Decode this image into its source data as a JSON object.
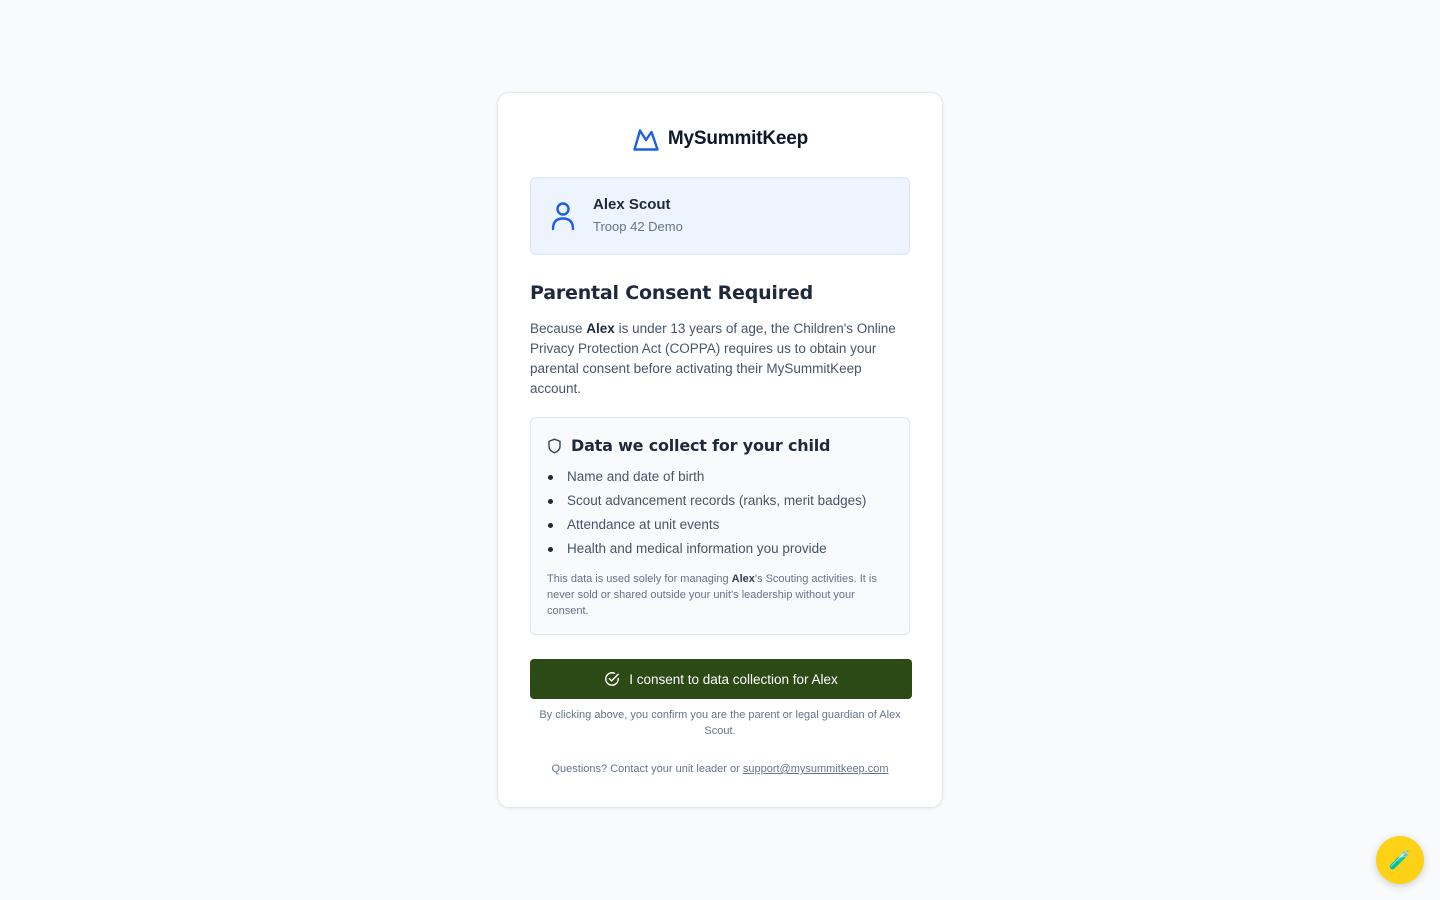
{
  "brand": {
    "name": "MySummitKeep",
    "icon": "mountain-icon",
    "accent": "#1d5fe0"
  },
  "user": {
    "name": "Alex Scout",
    "troop": "Troop 42 Demo",
    "icon": "user-icon"
  },
  "consent": {
    "title": "Parental Consent Required",
    "desc_pre": "Because ",
    "child_first_name": "Alex",
    "desc_post": " is under 13 years of age, the Children's Online Privacy Protection Act (COPPA) requires us to obtain your parental consent before activating their MySummitKeep account."
  },
  "data_box": {
    "title": "Data we collect for your child",
    "icon": "shield-icon",
    "items": [
      "Name and date of birth",
      "Scout advancement records (ranks, merit badges)",
      "Attendance at unit events",
      "Health and medical information you provide"
    ],
    "note_pre": "This data is used solely for managing ",
    "note_name": "Alex",
    "note_post": "'s Scouting activities. It is never sold or shared outside your unit's leadership without your consent."
  },
  "button": {
    "label": "I consent to data collection for Alex",
    "icon": "check-circle-icon",
    "color": "#2b4a15"
  },
  "confirm_text": "By clicking above, you confirm you are the parent or legal guardian of Alex Scout.",
  "questions": {
    "text": "Questions? Contact your unit leader or ",
    "link": "support@mysummitkeep.com"
  },
  "fab": {
    "icon": "test-tube-icon",
    "glyph": "🧪",
    "color": "#fcd116"
  }
}
